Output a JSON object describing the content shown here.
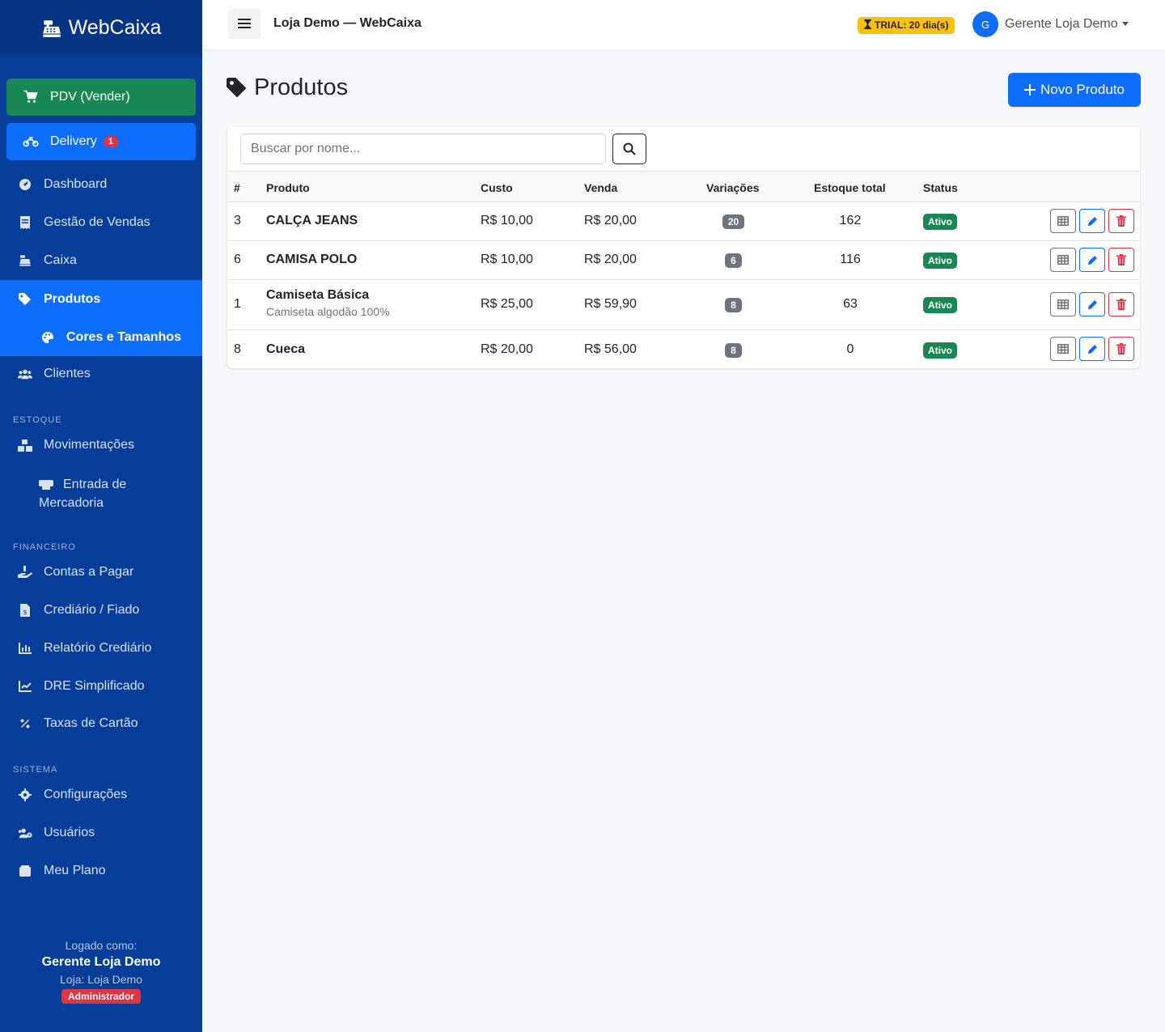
{
  "brand": {
    "name": "WebCaixa",
    "icon": "cash-register-icon"
  },
  "sidebar": {
    "pdv_label": "PDV (Vender)",
    "delivery_label": "Delivery",
    "delivery_badge": "1",
    "items": [
      {
        "label": "Dashboard",
        "icon": "gauge-icon"
      },
      {
        "label": "Gestão de Vendas",
        "icon": "receipt-icon"
      },
      {
        "label": "Caixa",
        "icon": "cash-register-icon"
      },
      {
        "label": "Produtos",
        "icon": "tag-icon"
      },
      {
        "label": "Cores e Tamanhos",
        "icon": "palette-icon"
      },
      {
        "label": "Clientes",
        "icon": "users-icon"
      }
    ],
    "section_estoque": "ESTOQUE",
    "estoque_items": [
      {
        "label": "Movimentações",
        "icon": "boxes-icon"
      },
      {
        "label": "Entrada de Mercadoria",
        "icon": "truck-loading-icon"
      }
    ],
    "section_financeiro": "FINANCEIRO",
    "financeiro_items": [
      {
        "label": "Contas a Pagar",
        "icon": "hand-coin-icon"
      },
      {
        "label": "Crediário / Fiado",
        "icon": "file-invoice-icon"
      },
      {
        "label": "Relatório Crediário",
        "icon": "bar-chart-icon"
      },
      {
        "label": "DRE Simplificado",
        "icon": "line-chart-icon"
      },
      {
        "label": "Taxas de Cartão",
        "icon": "percent-icon"
      }
    ],
    "section_sistema": "SISTEMA",
    "sistema_items": [
      {
        "label": "Configurações",
        "icon": "gear-icon"
      },
      {
        "label": "Usuários",
        "icon": "users-gear-icon"
      },
      {
        "label": "Meu Plano",
        "icon": "wallet-icon"
      }
    ],
    "footer": {
      "logged_as": "Logado como:",
      "user": "Gerente Loja Demo",
      "store": "Loja: Loja Demo",
      "role": "Administrador"
    }
  },
  "topbar": {
    "title": "Loja Demo — WebCaixa",
    "trial": "TRIAL: 20 dia(s)",
    "avatar_initial": "G",
    "user_name": "Gerente Loja Demo"
  },
  "page": {
    "title": "Produtos",
    "new_button": "Novo Produto",
    "search_placeholder": "Buscar por nome..."
  },
  "table": {
    "headers": [
      "#",
      "Produto",
      "Custo",
      "Venda",
      "Variações",
      "Estoque total",
      "Status"
    ],
    "rows": [
      {
        "id": "3",
        "name": "CALÇA JEANS",
        "desc": "",
        "cost": "R$ 10,00",
        "price": "R$ 20,00",
        "variations": "20",
        "stock": "162",
        "status": "Ativo"
      },
      {
        "id": "6",
        "name": "CAMISA POLO",
        "desc": "",
        "cost": "R$ 10,00",
        "price": "R$ 20,00",
        "variations": "6",
        "stock": "116",
        "status": "Ativo"
      },
      {
        "id": "1",
        "name": "Camiseta Básica",
        "desc": "Camiseta algodão 100%",
        "cost": "R$ 25,00",
        "price": "R$ 59,90",
        "variations": "8",
        "stock": "63",
        "status": "Ativo"
      },
      {
        "id": "8",
        "name": "Cueca",
        "desc": "",
        "cost": "R$ 20,00",
        "price": "R$ 56,00",
        "variations": "8",
        "stock": "0",
        "status": "Ativo"
      }
    ]
  },
  "colors": {
    "sidebar_bg": "#053d98",
    "primary": "#0d6efd",
    "success": "#198754",
    "danger": "#dc3545",
    "warning": "#ffc107"
  }
}
